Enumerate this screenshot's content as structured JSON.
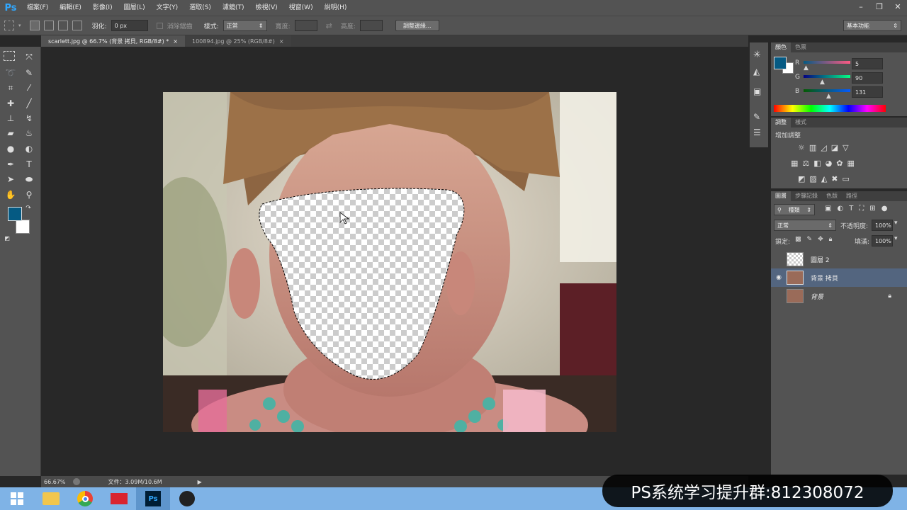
{
  "app": {
    "logo": "Ps",
    "menu": [
      "檔案(F)",
      "編輯(E)",
      "影像(I)",
      "圖層(L)",
      "文字(Y)",
      "選取(S)",
      "濾鏡(T)",
      "檢視(V)",
      "視窗(W)",
      "說明(H)"
    ]
  },
  "options": {
    "feather_label": "羽化:",
    "feather_value": "0 px",
    "antialias_label": "消除鋸齒",
    "style_label": "樣式:",
    "style_value": "正常",
    "width_label": "寬度:",
    "height_label": "高度:",
    "refine_button": "調整邊緣...",
    "workspace": "基本功能"
  },
  "tabs": [
    {
      "label": "scarlett.jpg @ 66.7% (背景 拷貝, RGB/8#) *",
      "close": "×"
    },
    {
      "label": "100894.jpg @ 25% (RGB/8#)",
      "close": "×"
    }
  ],
  "status": {
    "zoom": "66.67%",
    "doc": "文件：3.09M/10.6M"
  },
  "color_panel": {
    "tabs": [
      "顏色",
      "色票"
    ],
    "channels": [
      {
        "name": "R",
        "value": "5"
      },
      {
        "name": "G",
        "value": "90"
      },
      {
        "name": "B",
        "value": "131"
      }
    ],
    "foreground": "#055a83",
    "background": "#ffffff"
  },
  "adjust_panel": {
    "tabs": [
      "調整",
      "樣式"
    ],
    "title": "增加調整"
  },
  "layers_panel": {
    "tabs": [
      "圖層",
      "步驟記錄",
      "色版",
      "路徑"
    ],
    "filter": "種類",
    "blend_mode": "正常",
    "opacity_label": "不透明度:",
    "opacity_value": "100%",
    "lock_label": "鎖定:",
    "fill_label": "填滿:",
    "fill_value": "100%",
    "layers": [
      {
        "name": "圖層 2",
        "visible": false,
        "selected": false
      },
      {
        "name": "背景 拷貝",
        "visible": true,
        "selected": true
      },
      {
        "name": "背景",
        "visible": false,
        "selected": false,
        "locked": true
      }
    ]
  },
  "promo": "PS系统学习提升群:812308072"
}
